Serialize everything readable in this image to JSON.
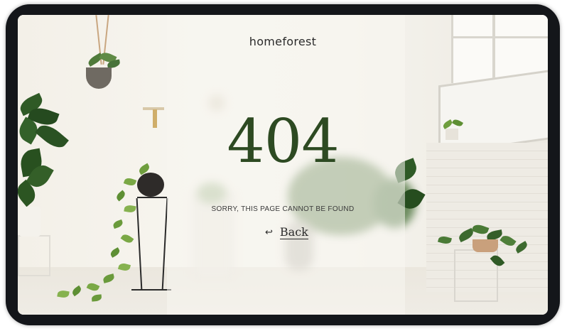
{
  "brand": {
    "name": "homeforest"
  },
  "error": {
    "code": "404",
    "message": "SORRY, THIS PAGE CANNOT BE FOUND"
  },
  "back_link": {
    "icon": "return-arrow-icon",
    "arrow_glyph": "↩",
    "label": "Back"
  },
  "colors": {
    "accent_green": "#2d4a22",
    "device_bezel": "#14161a",
    "text": "#2b2b2b"
  }
}
